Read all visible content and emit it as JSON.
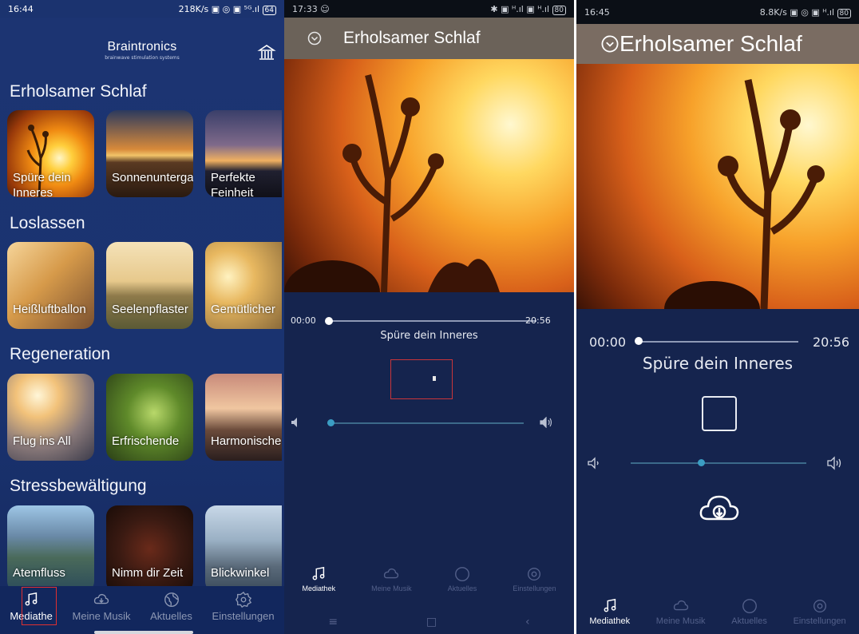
{
  "screen1": {
    "status": {
      "time": "16:44",
      "right": "218K/s ▣ ◎ ▣ ⁵ᴳ.ıl",
      "battery": "64"
    },
    "brand": "Braintronics",
    "brand_sub": "brainwave stimulation systems",
    "sections": [
      {
        "title": "Erholsamer Schlaf",
        "cards": [
          "Spüre dein Inneres",
          "Sonnenuntergang",
          "Perfekte Feinheit"
        ]
      },
      {
        "title": "Loslassen",
        "cards": [
          "Heißluftballon",
          "Seelenpflaster",
          "Gemütlicher"
        ]
      },
      {
        "title": "Regeneration",
        "cards": [
          "Flug ins All",
          "Erfrischende",
          "Harmonische"
        ]
      },
      {
        "title": "Stressbewältigung",
        "cards": [
          "Atemfluss",
          "Nimm dir Zeit",
          "Blickwinkel"
        ]
      }
    ],
    "nav": [
      "Mediathe",
      "Meine Musik",
      "Aktuelles",
      "Einstellungen"
    ]
  },
  "screen2": {
    "status": {
      "time": "17:33 ☺",
      "right": "✱ ▣ ᴴ.ıl ▣ ᴴ.ıl",
      "battery": "80"
    },
    "title": "Erholsamer Schlaf",
    "time_start": "00:00",
    "time_end": "20:56",
    "track": "Spüre dein Inneres",
    "progress": 0.0,
    "volume": 0.02,
    "nav": [
      "Mediathek",
      "Meine Musik",
      "Aktuelles",
      "Einstellungen"
    ]
  },
  "screen3": {
    "status": {
      "time": "16:45",
      "right": "8.8K/s ▣ ◎ ▣ ᴴ.ıl",
      "battery": "80"
    },
    "title": "Erholsamer Schlaf",
    "time_start": "00:00",
    "time_end": "20:56",
    "track": "Spüre dein Inneres",
    "progress": 0.0,
    "volume": 0.4,
    "nav": [
      "Mediathek",
      "Meine Musik",
      "Aktuelles",
      "Einstellungen"
    ]
  },
  "colors": {
    "accent": "#3b9dc3",
    "highlight_box": "#e03030",
    "background": "#15244e"
  }
}
